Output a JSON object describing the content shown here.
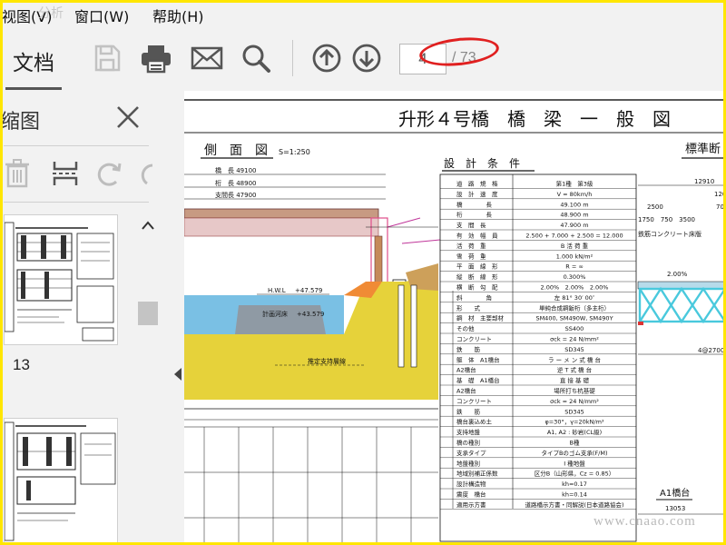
{
  "menubar": {
    "items": [
      "视图(V)",
      "窗口(W)",
      "帮助(H)"
    ],
    "watermark": "分析"
  },
  "toolbar": {
    "doc_tab_label": "文档",
    "page_input_value": "4",
    "page_total": "/ 73"
  },
  "panel": {
    "title": "缩图",
    "thumb_label": "13"
  },
  "drawing": {
    "title": "升形４号橋　橋　梁　一　般　図",
    "side_view_label": "側　面　図",
    "side_view_scale": "S=1:250",
    "design_conditions_label": "設　計　条　件",
    "standard_section_label": "標準断",
    "dims": [
      "橋　長 49100",
      "桁　長 48900",
      "支間長 47900"
    ],
    "water_levels": [
      "H.W.L",
      "+47.579",
      "計画河床",
      "+43.579"
    ],
    "bearing_layer": "推定支持層線",
    "slab_label": "鉄筋コンクリート床版",
    "a1_label": "A1橋台",
    "a1_dim": "13053",
    "table_rows": [
      [
        "道　路　規　格",
        "第1種　第3級"
      ],
      [
        "設　計　速　度",
        "V = 80km/h"
      ],
      [
        "橋　　　　長",
        "49.100 m"
      ],
      [
        "桁　　　　長",
        "48.900 m"
      ],
      [
        "支　間　長",
        "47.900 m"
      ],
      [
        "有　効　幅　員",
        "2.500 + 7.000 + 2.500 = 12.000"
      ],
      [
        "活　荷　重",
        "B 活 荷 重"
      ],
      [
        "雪　荷　重",
        "1.000 kN/m²"
      ],
      [
        "平　面　線　形",
        "R = ∞"
      ],
      [
        "縦　断　線　形",
        "0.300%"
      ],
      [
        "横　断　勾　配",
        "2.00%　2.00%　2.00%"
      ],
      [
        "斜　　　　角",
        "左 81° 30′ 00″"
      ],
      [
        "形　　式",
        "単純合成鋼鈑桁（多主桁）"
      ],
      [
        "鋼　材　主要部材",
        "SM400, SM490W, SM490Y"
      ],
      [
        "その他",
        "SS400"
      ],
      [
        "コンクリート",
        "σck = 24 N/mm²"
      ],
      [
        "鉄　　筋",
        "SD345"
      ],
      [
        "躯　体　A1橋台",
        "ラ ー メ ン 式 橋 台"
      ],
      [
        "A2橋台",
        "逆 T 式 橋 台"
      ],
      [
        "基　礎　A1橋台",
        "直 接 基 礎"
      ],
      [
        "A2橋台",
        "場所打ち杭基礎"
      ],
      [
        "コンクリート",
        "σck = 24 N/mm²"
      ],
      [
        "鉄　　筋",
        "SD345"
      ],
      [
        "橋台裏込め土",
        "φ=30°，γ=20kN/m³"
      ],
      [
        "支持地盤",
        "A1, A2 : 砂岩(CL級)"
      ],
      [
        "橋の種別",
        "B種"
      ],
      [
        "支承タイプ",
        "タイプBのゴム支承(F/M)"
      ],
      [
        "地盤種別",
        "Ⅰ 種地盤"
      ],
      [
        "地域別補正係数",
        "区分B（山形県，Cz = 0.85）"
      ],
      [
        "設計構造物",
        "kh=0.17"
      ],
      [
        "震度　橋台",
        "kh=0.14"
      ],
      [
        "適用示方書",
        "道路橋示方書・同解説(日本道路協会)"
      ]
    ]
  },
  "footer_watermark": "www.cnaao.com",
  "colors": {
    "accent_red": "#e02020",
    "frame_yellow": "#ffe600",
    "water": "#7ac0e4",
    "soil": "#e6d23a",
    "rock": "#cda05a",
    "slab_pink": "#d8a0a0",
    "truss_cyan": "#49c9dd"
  }
}
